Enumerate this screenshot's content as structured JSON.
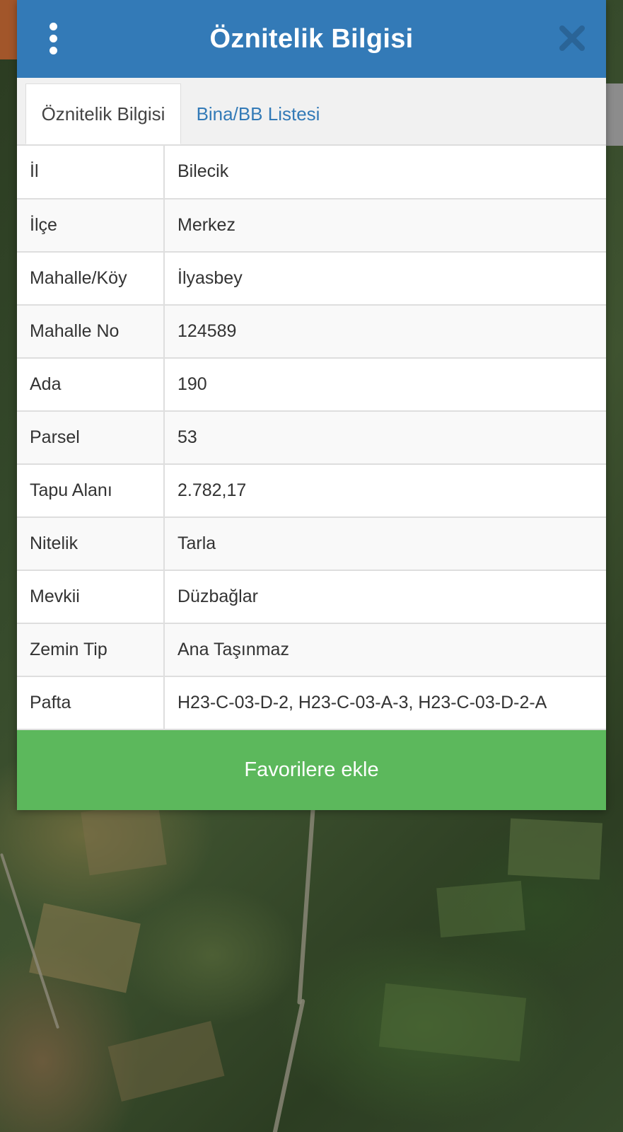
{
  "dialog": {
    "title": "Öznitelik Bilgisi",
    "menu_icon": "more-vertical-icon",
    "close_icon": "close-icon",
    "header_color": "#337ab7"
  },
  "tabs": [
    {
      "label": "Öznitelik Bilgisi",
      "active": true
    },
    {
      "label": "Bina/BB Listesi",
      "active": false
    }
  ],
  "attributes": [
    {
      "key": "İl",
      "value": "Bilecik"
    },
    {
      "key": "İlçe",
      "value": "Merkez"
    },
    {
      "key": "Mahalle/Köy",
      "value": "İlyasbey"
    },
    {
      "key": "Mahalle No",
      "value": "124589"
    },
    {
      "key": "Ada",
      "value": "190"
    },
    {
      "key": "Parsel",
      "value": "53"
    },
    {
      "key": "Tapu Alanı",
      "value": "2.782,17"
    },
    {
      "key": "Nitelik",
      "value": "Tarla"
    },
    {
      "key": "Mevkii",
      "value": "Düzbağlar"
    },
    {
      "key": "Zemin Tip",
      "value": "Ana Taşınmaz"
    },
    {
      "key": "Pafta",
      "value": "H23-C-03-D-2, H23-C-03-A-3, H23-C-03-D-2-A"
    }
  ],
  "favorite_button": {
    "label": "Favorilere ekle",
    "color": "#5cb85c"
  }
}
